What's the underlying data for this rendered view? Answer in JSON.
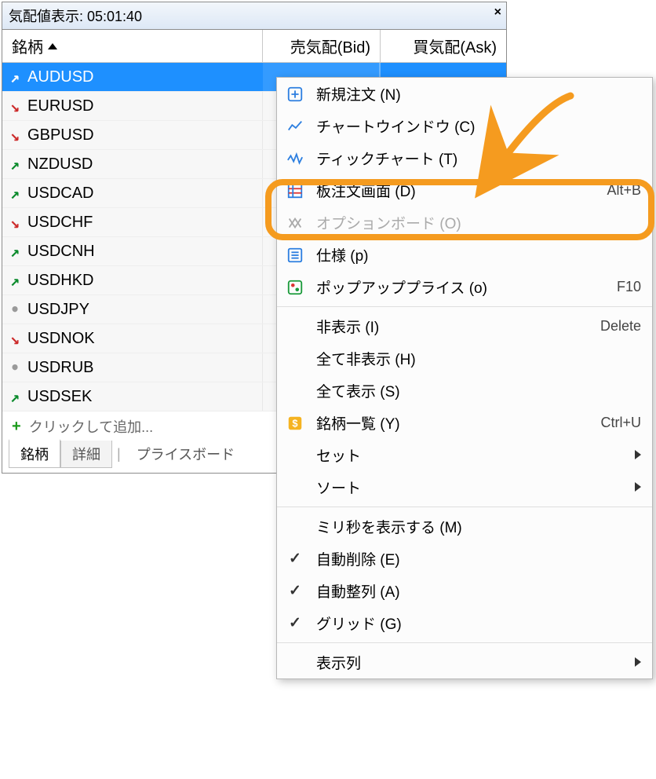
{
  "panel": {
    "title": "気配値表示: 05:01:40",
    "columns": {
      "symbol": "銘柄",
      "bid": "売気配(Bid)",
      "ask": "買気配(Ask)"
    },
    "rows": [
      {
        "dir": "up",
        "symbol": "AUDUSD",
        "selected": true
      },
      {
        "dir": "down",
        "symbol": "EURUSD"
      },
      {
        "dir": "down",
        "symbol": "GBPUSD"
      },
      {
        "dir": "up",
        "symbol": "NZDUSD"
      },
      {
        "dir": "up",
        "symbol": "USDCAD"
      },
      {
        "dir": "down",
        "symbol": "USDCHF"
      },
      {
        "dir": "up",
        "symbol": "USDCNH"
      },
      {
        "dir": "up",
        "symbol": "USDHKD"
      },
      {
        "dir": "flat",
        "symbol": "USDJPY"
      },
      {
        "dir": "down",
        "symbol": "USDNOK"
      },
      {
        "dir": "flat",
        "symbol": "USDRUB"
      },
      {
        "dir": "up",
        "symbol": "USDSEK"
      }
    ],
    "add_hint": "クリックして追加...",
    "tabs": {
      "symbols": "銘柄",
      "details": "詳細",
      "priceboard": "プライスボード"
    }
  },
  "menu": {
    "new_order": "新規注文 (N)",
    "chart_window": "チャートウインドウ (C)",
    "tick_chart": "ティックチャート (T)",
    "depth": "板注文画面 (D)",
    "depth_shortcut": "Alt+B",
    "option_board": "オプションボード (O)",
    "spec": "仕様 (p)",
    "popup_price": "ポップアッププライス (o)",
    "popup_shortcut": "F10",
    "hide": "非表示 (I)",
    "hide_shortcut": "Delete",
    "hide_all": "全て非表示 (H)",
    "show_all": "全て表示 (S)",
    "symbols_list": "銘柄一覧 (Y)",
    "symbols_shortcut": "Ctrl+U",
    "sets": "セット",
    "sort": "ソート",
    "show_ms": "ミリ秒を表示する (M)",
    "auto_delete": "自動削除 (E)",
    "auto_arrange": "自動整列 (A)",
    "grid": "グリッド (G)",
    "columns": "表示列"
  }
}
